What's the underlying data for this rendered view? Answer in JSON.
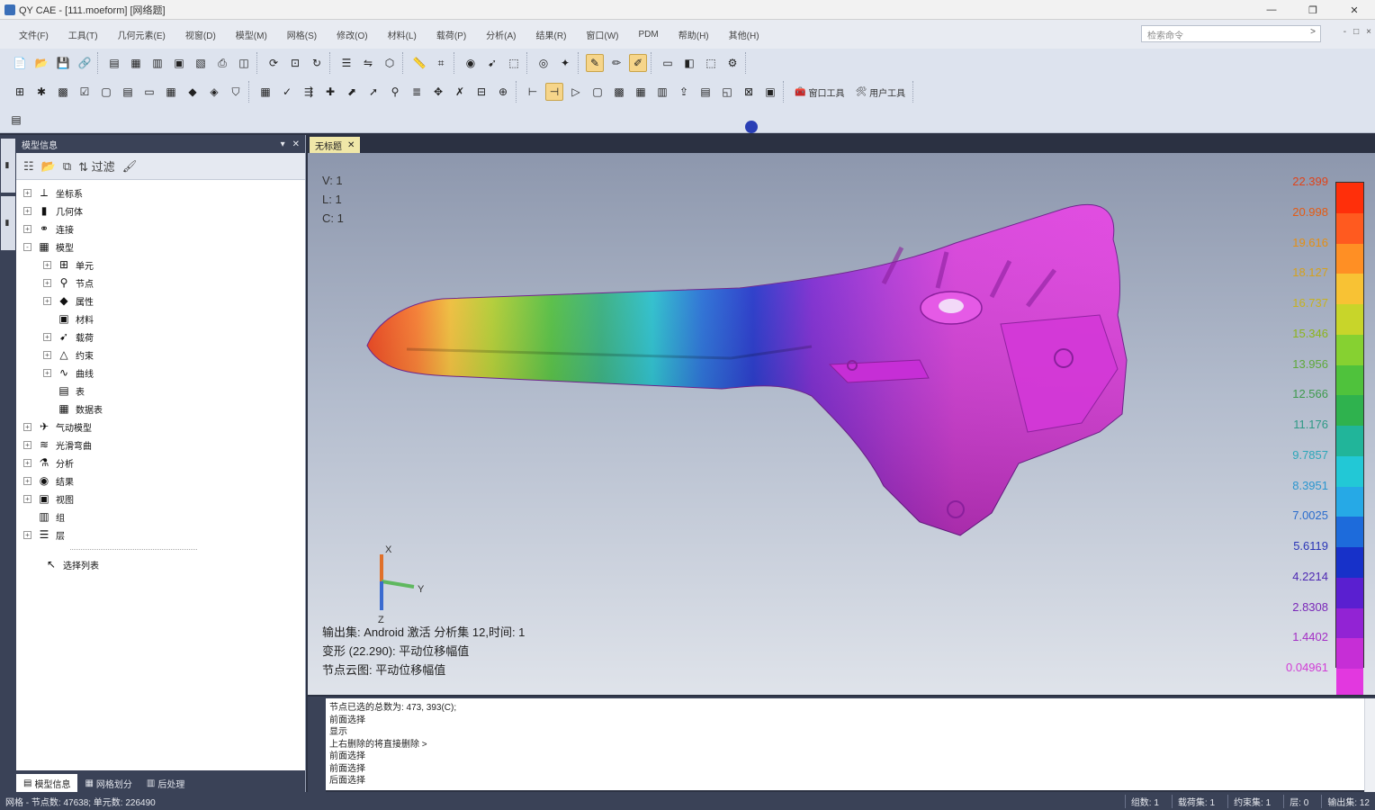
{
  "window": {
    "title": "QY CAE - [111.moeform] [网络题]",
    "controls": [
      "—",
      "❐",
      "✕"
    ]
  },
  "menu": {
    "items": [
      "文件(F)",
      "工具(T)",
      "几何元素(E)",
      "视窗(D)",
      "模型(M)",
      "网格(S)",
      "修改(O)",
      "材料(L)",
      "载荷(P)",
      "分析(A)",
      "结果(R)",
      "窗口(W)",
      "PDM",
      "帮助(H)",
      "其他(H)"
    ],
    "search_placeholder": "检索命令",
    "search_go": ">",
    "mdi_controls": [
      "-",
      "□",
      "×"
    ]
  },
  "toolbar": {
    "group_labels": [
      "窗口工具",
      "用户工具"
    ]
  },
  "left_panel": {
    "title": "模型信息",
    "header_controls": [
      "▾",
      "✕"
    ],
    "toolbar_label": "过滤",
    "tree": [
      {
        "label": "坐标系",
        "level": 0,
        "icon": "axes-icon",
        "exp": "+"
      },
      {
        "label": "几何体",
        "level": 0,
        "icon": "geometry-icon",
        "exp": "+"
      },
      {
        "label": "连接",
        "level": 0,
        "icon": "connect-icon",
        "exp": "+"
      },
      {
        "label": "模型",
        "level": 0,
        "icon": "model-icon",
        "exp": "-"
      },
      {
        "label": "单元",
        "level": 1,
        "icon": "element-icon",
        "exp": "+"
      },
      {
        "label": "节点",
        "level": 1,
        "icon": "node-icon",
        "exp": "+"
      },
      {
        "label": "属性",
        "level": 1,
        "icon": "property-icon",
        "exp": "+"
      },
      {
        "label": "材料",
        "level": 1,
        "icon": "material-icon",
        "exp": ""
      },
      {
        "label": "载荷",
        "level": 1,
        "icon": "load-icon",
        "exp": "+"
      },
      {
        "label": "约束",
        "level": 1,
        "icon": "constraint-icon",
        "exp": "+"
      },
      {
        "label": "曲线",
        "level": 1,
        "icon": "curve-icon",
        "exp": "+"
      },
      {
        "label": "表",
        "level": 1,
        "icon": "table-icon",
        "exp": ""
      },
      {
        "label": "数据表",
        "level": 1,
        "icon": "datatable-icon",
        "exp": ""
      },
      {
        "label": "气动模型",
        "level": 0,
        "icon": "aero-icon",
        "exp": "+"
      },
      {
        "label": "光滑弯曲",
        "level": 0,
        "icon": "smooth-icon",
        "exp": "+"
      },
      {
        "label": "分析",
        "level": 0,
        "icon": "analysis-icon",
        "exp": "+"
      },
      {
        "label": "结果",
        "level": 0,
        "icon": "result-icon",
        "exp": "+"
      },
      {
        "label": "视图",
        "level": 0,
        "icon": "view-icon",
        "exp": "+"
      },
      {
        "label": "组",
        "level": 0,
        "icon": "group-icon",
        "exp": ""
      },
      {
        "label": "层",
        "level": 0,
        "icon": "layer-icon",
        "exp": "+"
      }
    ],
    "select_all": "选择列表",
    "tabs": [
      "模型信息",
      "网格划分",
      "后处理"
    ]
  },
  "doc_tab": {
    "label": "无标题",
    "close": "✕"
  },
  "viewport": {
    "info": [
      "V: 1",
      "L: 1",
      "C: 1"
    ],
    "caption": [
      "输出集: Android 激活 分析集 12,时间: 1",
      "变形 (22.290): 平动位移幅值",
      "节点云图: 平动位移幅值"
    ],
    "axis_labels": [
      "X",
      "Y",
      "Z"
    ],
    "legend": {
      "labels": [
        "22.399",
        "20.998",
        "19.616",
        "18.127",
        "16.737",
        "15.346",
        "13.956",
        "12.566",
        "11.176",
        "9.7857",
        "8.3951",
        "7.0025",
        "5.6119",
        "4.2214",
        "2.8308",
        "1.4402",
        "0.04961"
      ],
      "label_colors": [
        "#e0431a",
        "#e45b13",
        "#e58f12",
        "#d6a11b",
        "#c7b21e",
        "#8cb41a",
        "#5ea93a",
        "#3f9a4d",
        "#2f9a86",
        "#2da7b9",
        "#2b96cf",
        "#2a6ccc",
        "#2a35b6",
        "#4f2ab3",
        "#7a27b8",
        "#a42ec5",
        "#d13dd6"
      ],
      "colors": [
        "#ff2f0a",
        "#ff5a1f",
        "#ff8f24",
        "#f8c234",
        "#c8d52a",
        "#86d131",
        "#4fc23c",
        "#2fb24e",
        "#21b59a",
        "#22c8d6",
        "#26a9e6",
        "#1d6bdb",
        "#1731c9",
        "#5a1fd0",
        "#9223d4",
        "#c62ed6",
        "#e238df"
      ]
    }
  },
  "console": {
    "lines": [
      "节点已选的总数为: 473, 393(C);",
      "前面选择",
      "显示",
      "上右删除的将直接删除 >",
      "前面选择",
      "前面选择",
      "后面选择"
    ]
  },
  "statusbar": {
    "left": "网格 - 节点数: 47638; 单元数: 226490",
    "right": [
      "组数: 1",
      "载荷集: 1",
      "约束集: 1",
      "层: 0",
      "输出集: 12"
    ]
  }
}
